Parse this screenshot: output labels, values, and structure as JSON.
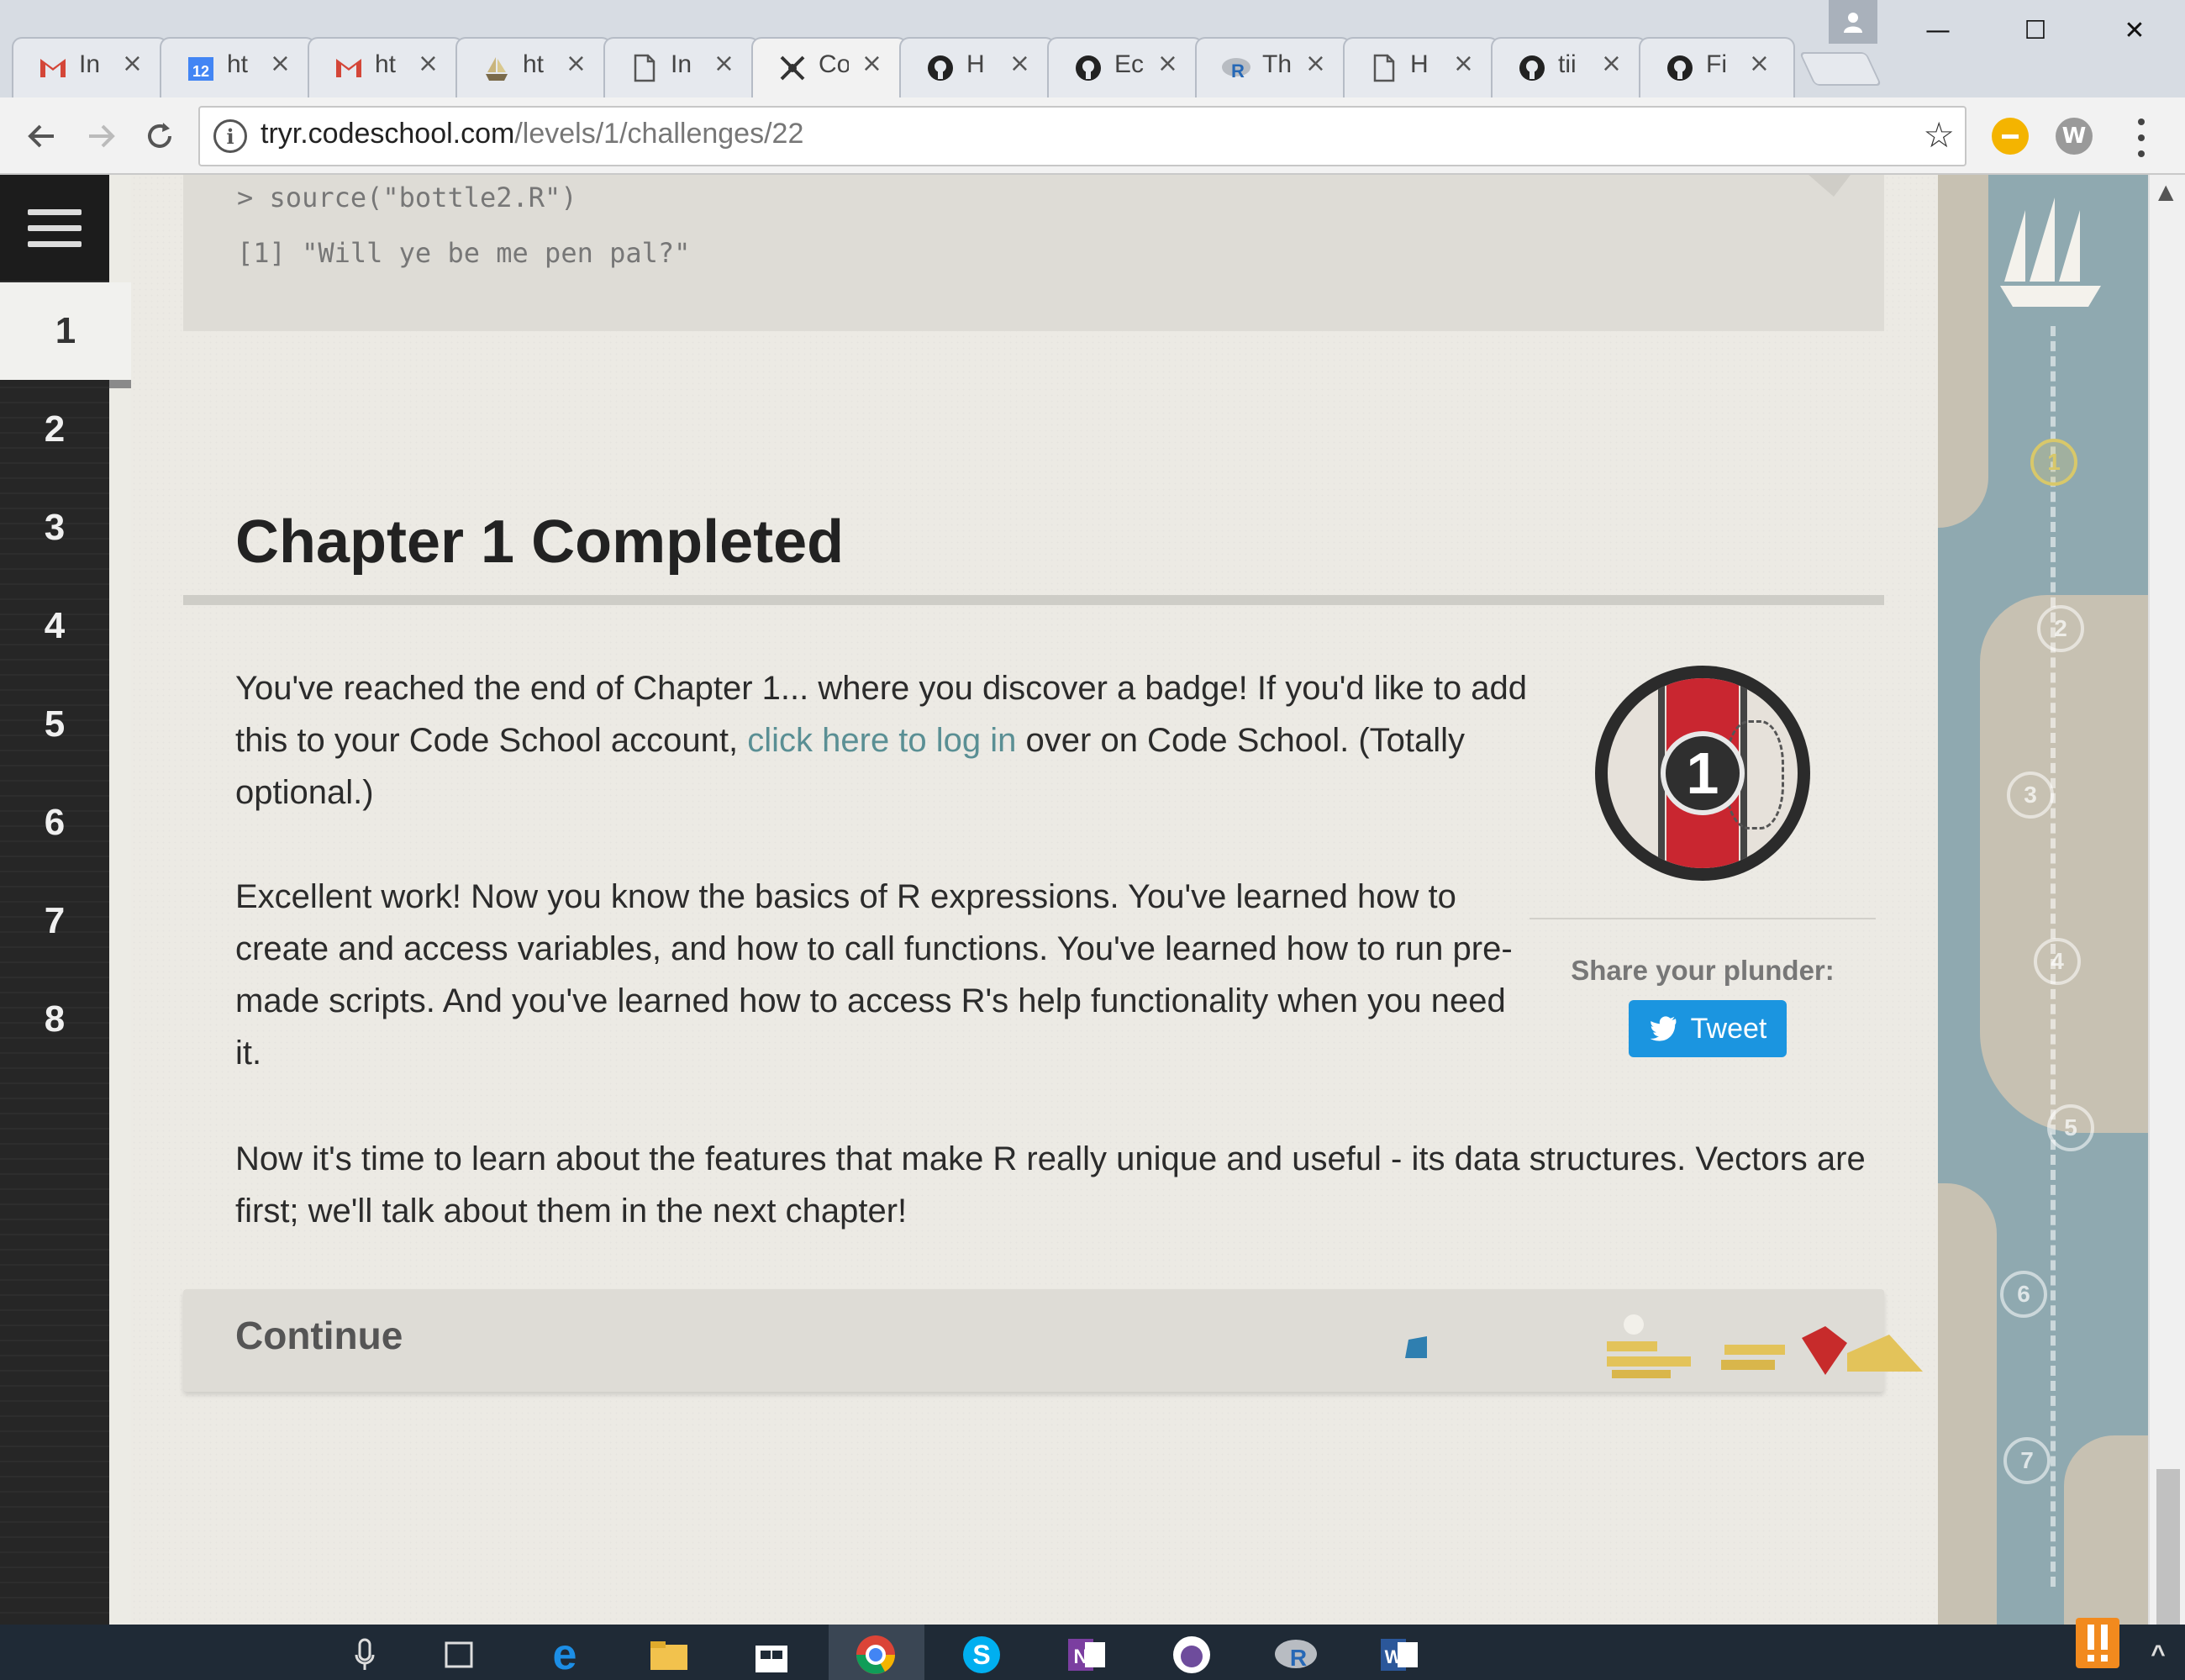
{
  "browser": {
    "tabs": [
      {
        "favicon": "gmail-icon",
        "title": "In",
        "x": 0
      },
      {
        "favicon": "calendar-icon",
        "title": "ht",
        "x": 0
      },
      {
        "favicon": "gmail-icon",
        "title": "ht",
        "x": 0
      },
      {
        "favicon": "ship-icon",
        "title": "ht",
        "x": 0
      },
      {
        "favicon": "document-icon",
        "title": "In",
        "x": 0
      },
      {
        "favicon": "codeschool-icon",
        "title": "Co",
        "x": 0
      },
      {
        "favicon": "github-icon",
        "title": "H",
        "x": 0
      },
      {
        "favicon": "github-icon",
        "title": "Ec",
        "x": 0
      },
      {
        "favicon": "r-icon",
        "title": "Th",
        "x": 0
      },
      {
        "favicon": "document-icon",
        "title": "H",
        "x": 0
      },
      {
        "favicon": "github-icon",
        "title": "tii",
        "x": 0
      },
      {
        "favicon": "github-icon",
        "title": "Fi",
        "x": 0
      }
    ],
    "active_tab_index": 5,
    "tab_close_glyph": "×",
    "url_host": "tryr.codeschool.com",
    "url_path": "/levels/1/challenges/22",
    "extension_w_label": "W",
    "window_controls": {
      "minimize": "—",
      "maximize": "☐",
      "close": "✕"
    }
  },
  "sidebar": {
    "chapters": [
      "1",
      "2",
      "3",
      "4",
      "5",
      "6",
      "7",
      "8"
    ],
    "active_chapter": "1"
  },
  "console": {
    "line1": "> source(\"bottle2.R\")",
    "line2": "[1] \"Will ye be me pen pal?\""
  },
  "main": {
    "title": "Chapter 1 Completed",
    "para1_before": "You've reached the end of Chapter 1... where you discover a badge! If you'd like to add this to your Code School account, ",
    "para1_link": "click here to log in",
    "para1_after": " over on Code School. (Totally optional.)",
    "para2": "Excellent work! Now you know the basics of R expressions. You've learned how to create and access variables, and how to call functions. You've learned how to run pre-made scripts. And you've learned how to access R's help functionality when you need it.",
    "para3": "Now it's time to learn about the features that make R really unique and useful - its data structures. Vectors are first; we'll talk about them in the next chapter!",
    "badge_number": "1",
    "share_label": "Share your plunder:",
    "tweet_label": "Tweet",
    "continue_label": "Continue"
  },
  "map": {
    "nodes": [
      "1",
      "2",
      "3",
      "4",
      "5",
      "6",
      "7"
    ],
    "completed": [
      "1"
    ]
  },
  "colors": {
    "link": "#5a8f94",
    "tweet": "#1b95e0",
    "badge_red": "#c92630",
    "sidebar": "#262626"
  }
}
